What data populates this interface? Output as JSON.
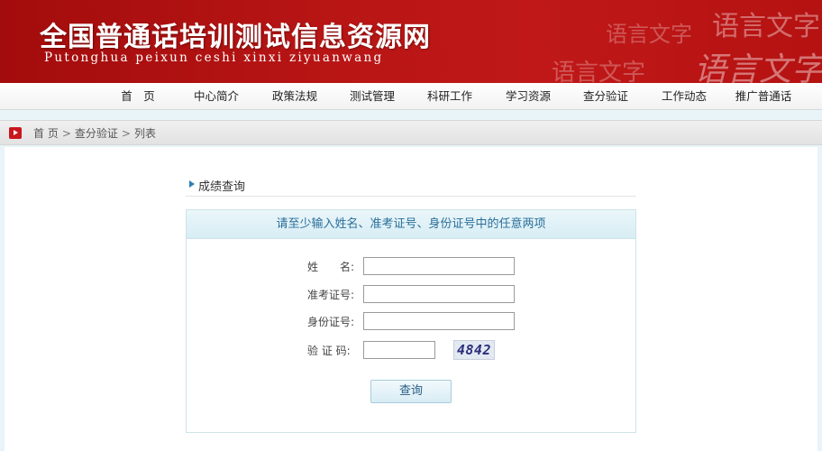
{
  "header": {
    "title": "全国普通话培训测试信息资源网",
    "subtitle": "Putonghua peixun ceshi xinxi ziyuanwang",
    "decor_text_1": "语言文字",
    "decor_text_2": "语言文字",
    "decor_text_3": "语言文字",
    "decor_text_4": "语言文字"
  },
  "nav": {
    "items": [
      "首　页",
      "中心简介",
      "政策法规",
      "测试管理",
      "科研工作",
      "学习资源",
      "查分验证",
      "工作动态",
      "推广普通话"
    ]
  },
  "breadcrumb": {
    "home": "首 页",
    "sep": ">",
    "section": "查分验证",
    "current": "列表"
  },
  "section": {
    "title": "成绩查询"
  },
  "form": {
    "instruction": "请至少输入姓名、准考证号、身份证号中的任意两项",
    "name_label": "姓　　名:",
    "ticket_label": "准考证号:",
    "id_label": "身份证号:",
    "captcha_label": "验 证 码:",
    "name_value": "",
    "ticket_value": "",
    "id_value": "",
    "captcha_value": "",
    "captcha_code": "4842",
    "submit_label": "查询"
  },
  "colors": {
    "banner_red": "#b81515",
    "accent_blue": "#2a6f9a",
    "crumb_icon_red": "#c8161d"
  }
}
